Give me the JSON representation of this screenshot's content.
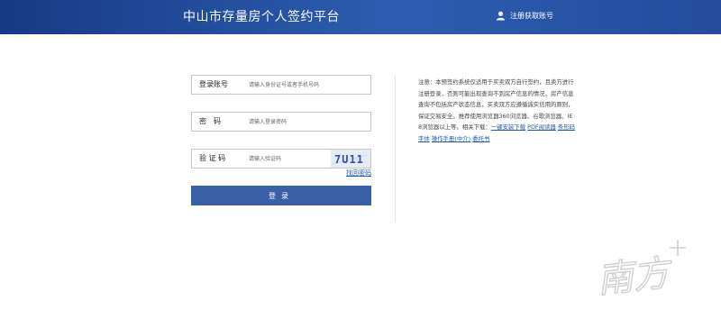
{
  "header": {
    "title": "中山市存量房个人签约平台",
    "register_label": "注册获取账号"
  },
  "login": {
    "account_label": "登录账号",
    "account_placeholder": "请输入身份证号或者手机号码",
    "password_label": "密　码",
    "password_placeholder": "请输入登录密码",
    "captcha_label": "验 证 码",
    "captcha_placeholder": "请输入验证码",
    "captcha_text": "7U11",
    "forgot_label": "找回密码",
    "submit_label": "登录"
  },
  "notice": {
    "text": "注意：本预签约系统仅适用于买卖双方自行签约，且卖方进行注册登录，否则可能出现查询不到房产信息的情况，房产信息查询不包括房产状态信息，买卖双方应遵循诚实信用的原则，保证交易安全。推荐使用浏览器360浏览器、谷歌浏览器、IE8浏览器以上等。",
    "downloads_prefix": "相关下载：",
    "links": [
      "一键安装下载",
      "PDF阅读器",
      "条形码字体",
      "操作手册(中介)",
      "委托书"
    ]
  },
  "watermark": {
    "text": "南方+"
  },
  "colors": {
    "header": "#2d5db1",
    "button": "#3a61a8",
    "link": "#2156b8"
  }
}
